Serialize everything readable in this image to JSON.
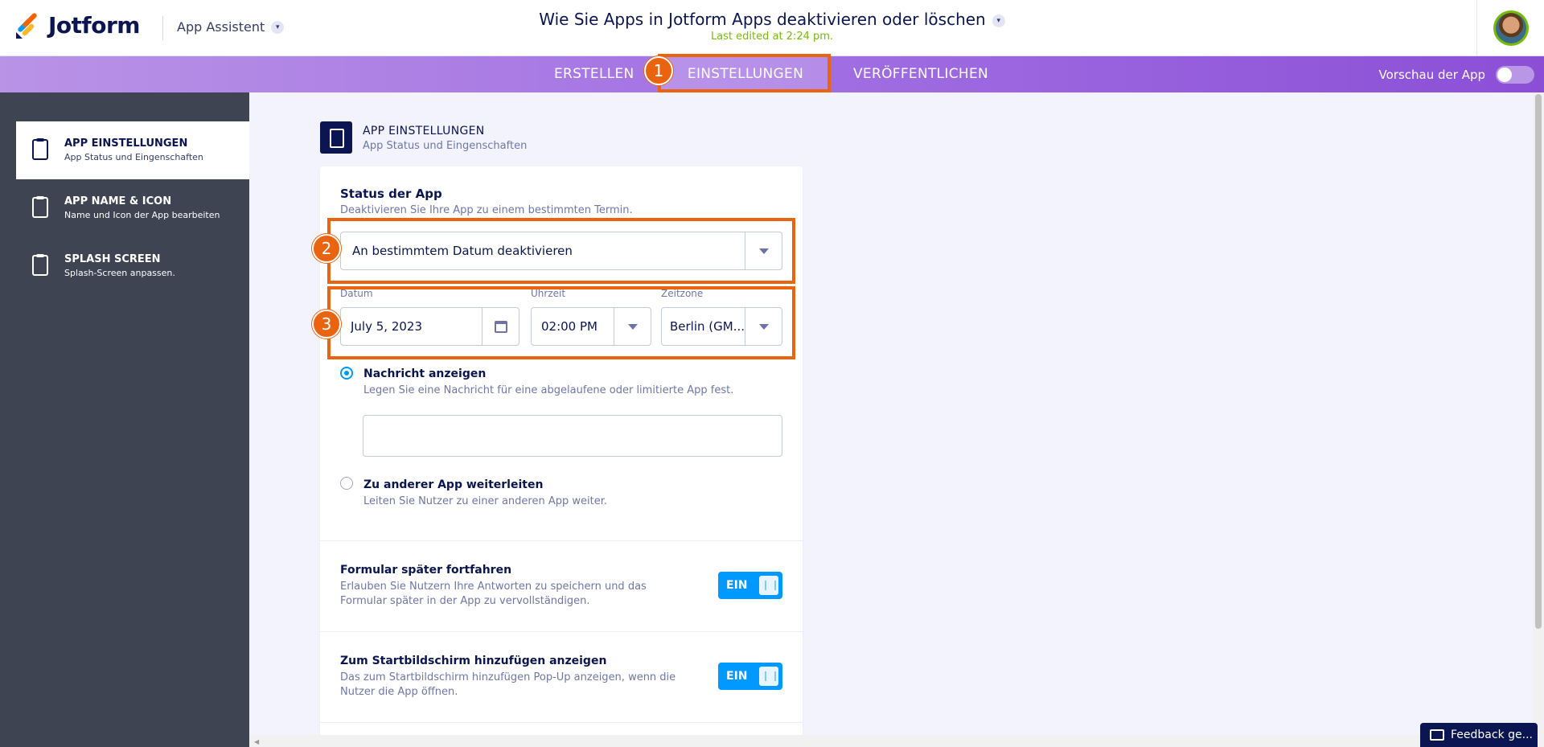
{
  "brand": {
    "name": "Jotform",
    "colors": {
      "purple": "#a270e3",
      "navy": "#0a1551",
      "blue": "#0099ff",
      "orange": "#ea640f",
      "green": "#78bb07"
    }
  },
  "header": {
    "context_label": "App Assistent",
    "doc_title": "Wie Sie Apps in Jotform Apps deaktivieren oder löschen",
    "last_edited": "Last edited at 2:24 pm."
  },
  "nav": {
    "tabs": [
      {
        "label": "ERSTELLEN"
      },
      {
        "label": "EINSTELLUNGEN",
        "active": true
      },
      {
        "label": "VERÖFFENTLICHEN"
      }
    ],
    "preview_label": "Vorschau der App",
    "preview_enabled": false
  },
  "sidebar": {
    "items": [
      {
        "title": "APP EINSTELLUNGEN",
        "sub": "App Status und Eingenschaften",
        "icon": "clipboard-gear-icon",
        "active": true
      },
      {
        "title": "APP NAME & ICON",
        "sub": "Name und Icon der App bearbeiten",
        "icon": "phone-edit-icon"
      },
      {
        "title": "SPLASH SCREEN",
        "sub": "Splash-Screen anpassen.",
        "icon": "clipboard-edit-icon"
      }
    ]
  },
  "section": {
    "title": "APP EINSTELLUNGEN",
    "sub": "App Status und Eingenschaften"
  },
  "status": {
    "label": "Status der App",
    "desc": "Deaktivieren Sie Ihre App zu einem bestimmten Termin.",
    "selected": "An bestimmtem Datum deaktivieren"
  },
  "schedule": {
    "date_label": "Datum",
    "date_value": "July 5, 2023",
    "time_label": "Uhrzeit",
    "time_value": "02:00 PM",
    "tz_label": "Zeitzone",
    "tz_value": "Berlin (GM..."
  },
  "options": {
    "message": {
      "label": "Nachricht anzeigen",
      "desc": "Legen Sie eine Nachricht für eine abgelaufene oder limitierte App fest.",
      "selected": true,
      "value": ""
    },
    "redirect": {
      "label": "Zu anderer App weiterleiten",
      "desc": "Leiten Sie Nutzer zu einer anderen App weiter.",
      "selected": false
    }
  },
  "toggles": {
    "continue_later": {
      "label": "Formular später fortfahren",
      "desc_line1": "Erlauben Sie Nutzern Ihre Antworten zu speichern und das",
      "desc_line2": "Formular später in der App zu vervollständigen.",
      "state": "EIN"
    },
    "homescreen": {
      "label": "Zum Startbildschirm hinzufügen anzeigen",
      "desc_line1": "Das zum Startbildschirm hinzufügen Pop-Up anzeigen, wenn die",
      "desc_line2": "Nutzer die App öffnen.",
      "state": "EIN"
    }
  },
  "annotations": [
    "1",
    "2",
    "3"
  ],
  "feedback": {
    "label": "Feedback ge..."
  }
}
